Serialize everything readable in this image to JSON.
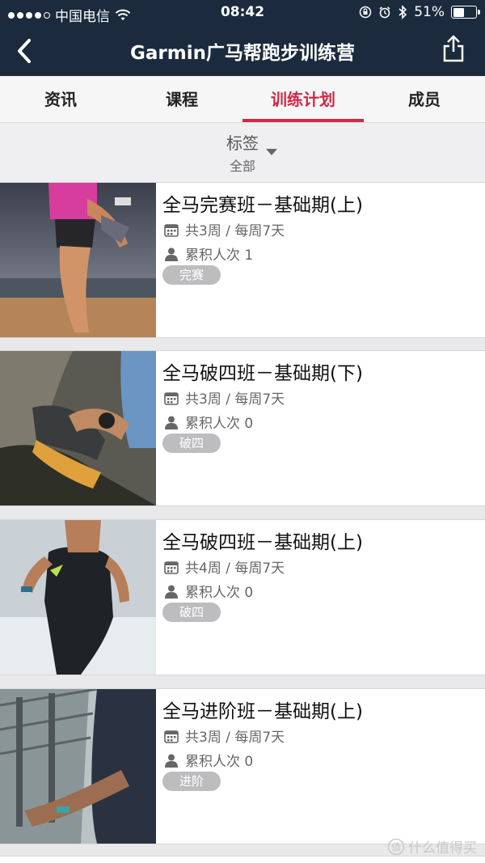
{
  "status_bar": {
    "carrier": "中国电信",
    "time": "08:42",
    "battery": "51%",
    "battery_level": 0.51
  },
  "nav": {
    "title": "Garmin广马帮跑步训练营",
    "back_icon": "chevron-left-icon",
    "share_icon": "share-icon"
  },
  "tabs": [
    {
      "label": "资讯",
      "active": false
    },
    {
      "label": "课程",
      "active": false
    },
    {
      "label": "训练计划",
      "active": true
    },
    {
      "label": "成员",
      "active": false
    }
  ],
  "filter": {
    "label": "标签",
    "value": "全部"
  },
  "courses": [
    {
      "name": "全马完赛班－基础期(上)",
      "duration": "共3周 / 每周7天",
      "participants": "累积人次 1",
      "tag": "完赛"
    },
    {
      "name": "全马破四班－基础期(下)",
      "duration": "共3周 / 每周7天",
      "participants": "累积人次 0",
      "tag": "破四"
    },
    {
      "name": "全马破四班－基础期(上)",
      "duration": "共4周 / 每周7天",
      "participants": "累积人次 0",
      "tag": "破四"
    },
    {
      "name": "全马进阶班－基础期(上)",
      "duration": "共3周 / 每周7天",
      "participants": "累积人次 0",
      "tag": "进阶"
    }
  ],
  "watermark": "什么值得买",
  "colors": {
    "nav_bg": "#1b2b3d",
    "accent": "#d32845",
    "tag_bg": "#bdbdc0"
  }
}
